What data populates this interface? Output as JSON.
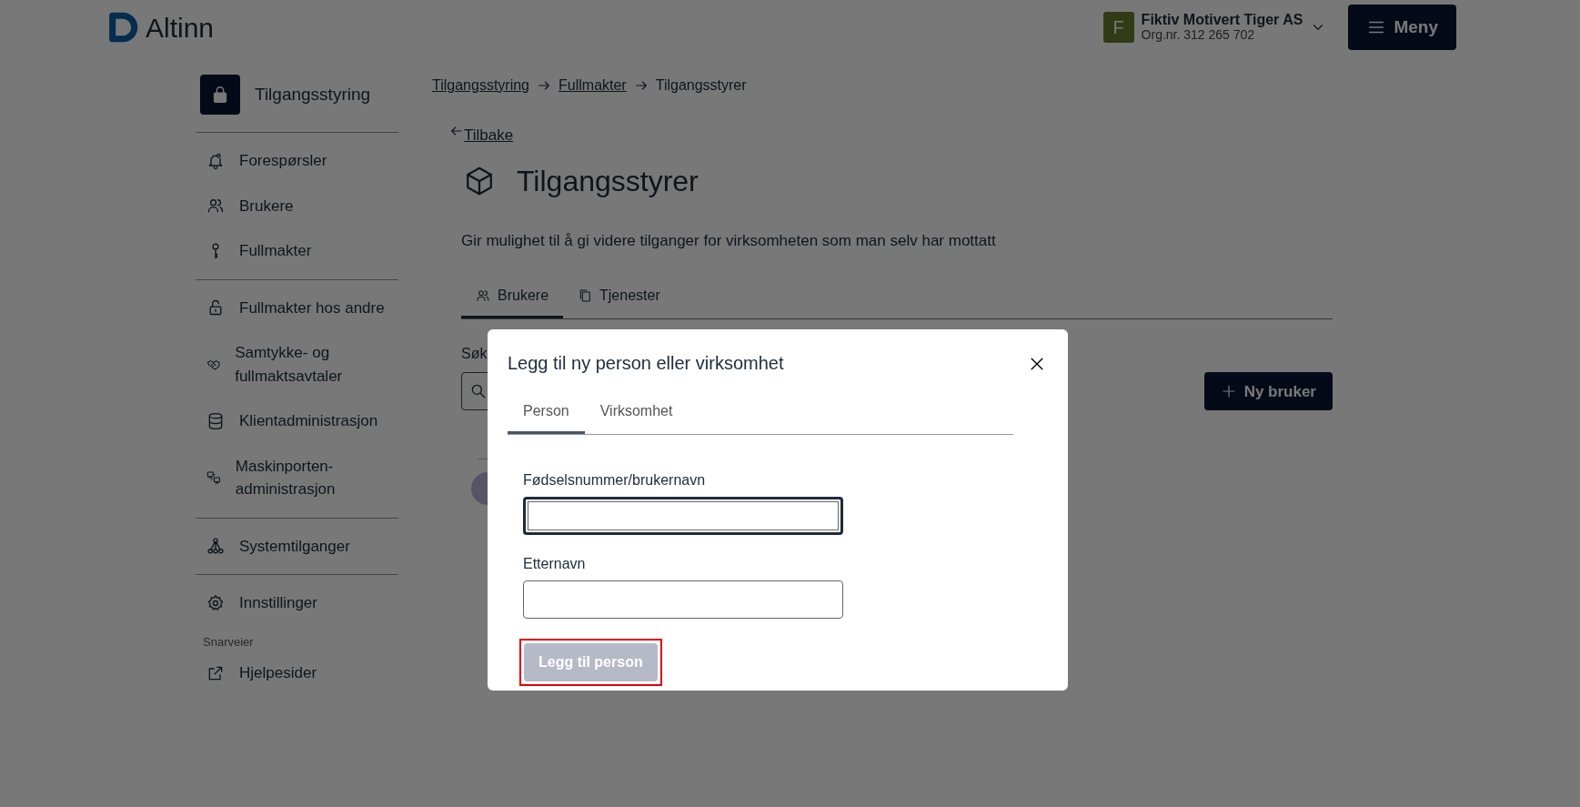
{
  "header": {
    "logo": "Altinn",
    "account": {
      "initial": "F",
      "name": "Fiktiv Motivert Tiger AS",
      "org": "Org.nr. 312 265 702"
    },
    "menu_button": "Meny"
  },
  "sidebar": {
    "title": "Tilgangsstyring",
    "groups": [
      [
        {
          "label": "Forespørsler"
        },
        {
          "label": "Brukere"
        },
        {
          "label": "Fullmakter"
        }
      ],
      [
        {
          "label": "Fullmakter hos andre"
        },
        {
          "label": "Samtykke- og fullmaktsavtaler"
        },
        {
          "label": "Klientadministrasjon"
        },
        {
          "label": "Maskinporten-administrasjon"
        }
      ],
      [
        {
          "label": "Systemtilganger"
        }
      ],
      [
        {
          "label": "Innstillinger"
        }
      ]
    ],
    "shortcuts_label": "Snarveier",
    "shortcuts": [
      {
        "label": "Hjelpesider"
      }
    ]
  },
  "main": {
    "breadcrumb": [
      {
        "label": "Tilgangsstyring",
        "link": true
      },
      {
        "label": "Fullmakter",
        "link": true
      },
      {
        "label": "Tilgangsstyrer",
        "link": false
      }
    ],
    "back_link": "Tilbake",
    "title": "Tilgangsstyrer",
    "description": "Gir mulighet til å gi videre tilganger for virksomheten som man selv har mottatt",
    "tabs": [
      {
        "label": "Brukere",
        "selected": true
      },
      {
        "label": "Tjenester",
        "selected": false
      }
    ],
    "search_label": "Søk",
    "new_user_button": "Ny bruker"
  },
  "modal": {
    "title": "Legg til ny person eller virksomhet",
    "tabs": [
      {
        "label": "Person",
        "selected": true
      },
      {
        "label": "Virksomhet",
        "selected": false
      }
    ],
    "fields": [
      {
        "label": "Fødselsnummer/brukernavn",
        "focused": true
      },
      {
        "label": "Etternavn",
        "focused": false
      }
    ],
    "submit": {
      "label": "Legg til person",
      "disabled": true,
      "highlighted": true
    }
  }
}
